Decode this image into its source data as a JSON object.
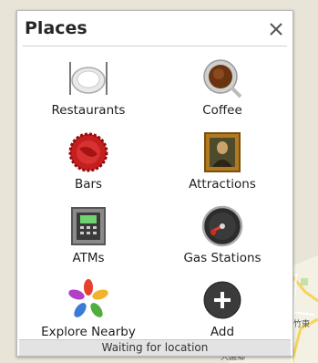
{
  "panel": {
    "title": "Places",
    "close_icon": "close-icon",
    "items": [
      {
        "label": "Restaurants",
        "icon": "plate-icon"
      },
      {
        "label": "Coffee",
        "icon": "coffee-cup-icon"
      },
      {
        "label": "Bars",
        "icon": "bottle-cap-icon"
      },
      {
        "label": "Attractions",
        "icon": "painting-icon"
      },
      {
        "label": "ATMs",
        "icon": "atm-icon"
      },
      {
        "label": "Gas Stations",
        "icon": "fuel-gauge-icon"
      },
      {
        "label": "Explore Nearby",
        "icon": "flower-icon"
      },
      {
        "label": "Add",
        "icon": "plus-circle-icon"
      }
    ],
    "status": "Waiting for location"
  },
  "map": {
    "visible_text": [
      "竹東",
      "大園鄉"
    ]
  },
  "colors": {
    "panel_bg": "#ffffff",
    "status_bg": "#e3e3e3"
  }
}
